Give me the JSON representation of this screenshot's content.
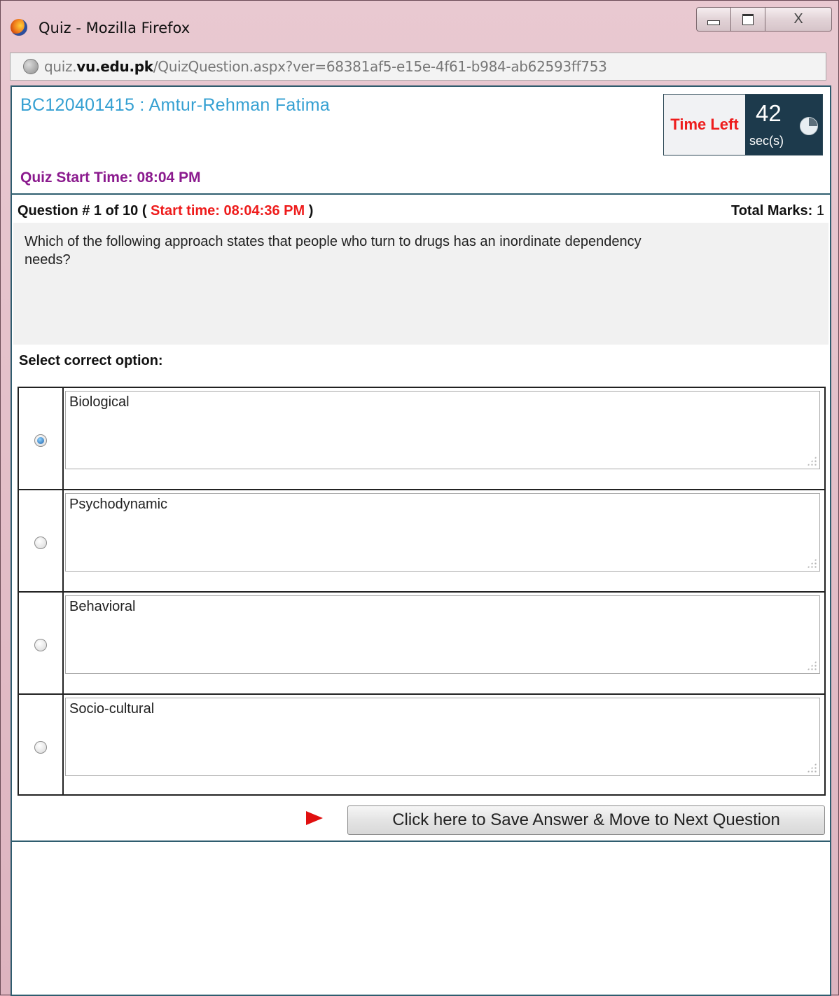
{
  "window": {
    "title": "Quiz - Mozilla Firefox",
    "close_glyph": "X"
  },
  "addressbar": {
    "url_prefix": "quiz.",
    "url_domain": "vu.edu.pk",
    "url_path": "/QuizQuestion.aspx?ver=68381af5-e15e-4f61-b984-ab62593ff753"
  },
  "quiz": {
    "student": "BC120401415 : Amtur-Rehman Fatima",
    "time_left_label": "Time Left",
    "time_left_value": "42",
    "time_left_unit": "sec(s)",
    "start_time": "Quiz Start Time: 08:04 PM",
    "question_header_prefix": "Question # 1 of 10 (",
    "question_start_time": "Start time: 08:04:36 PM",
    "question_header_suffix": ")",
    "total_marks_label": "Total Marks:",
    "total_marks_value": "1",
    "question_text": "Which of the following approach states that people who turn to drugs has an inordinate dependency needs?",
    "select_label": "Select correct option:",
    "options": [
      {
        "label": "Biological",
        "selected": true
      },
      {
        "label": "Psychodynamic",
        "selected": false
      },
      {
        "label": "Behavioral",
        "selected": false
      },
      {
        "label": "Socio-cultural",
        "selected": false
      }
    ],
    "save_button": "Click here to Save Answer & Move to Next Question"
  },
  "colors": {
    "accent_blue": "#35a0d2",
    "timer_red": "#ee1c1c",
    "start_purple": "#8b1a8e",
    "timer_dark": "#1d3a4c"
  }
}
